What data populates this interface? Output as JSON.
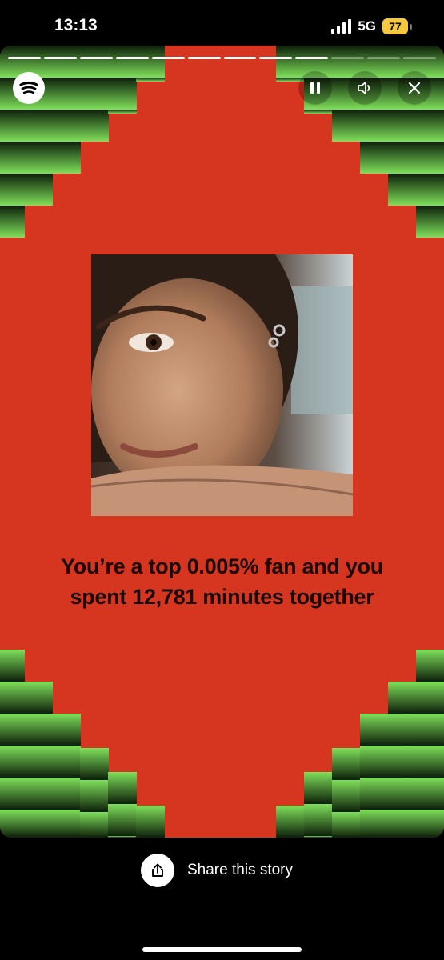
{
  "status_bar": {
    "time": "13:13",
    "network": "5G",
    "battery": "77"
  },
  "story": {
    "progress": {
      "total_segments": 12,
      "completed_segments": 9
    },
    "caption_line1": "You’re a top 0.005% fan and you",
    "caption_line2": "spent 12,781 minutes together",
    "colors": {
      "background": "#d6351f",
      "tile_green": "#7fe05a",
      "tile_dark": "#0d1f0a"
    }
  },
  "share": {
    "label": "Share this story"
  },
  "icons": {
    "logo": "spotify-logo-icon",
    "pause": "pause-icon",
    "volume": "volume-icon",
    "close": "close-icon",
    "share": "share-icon"
  }
}
